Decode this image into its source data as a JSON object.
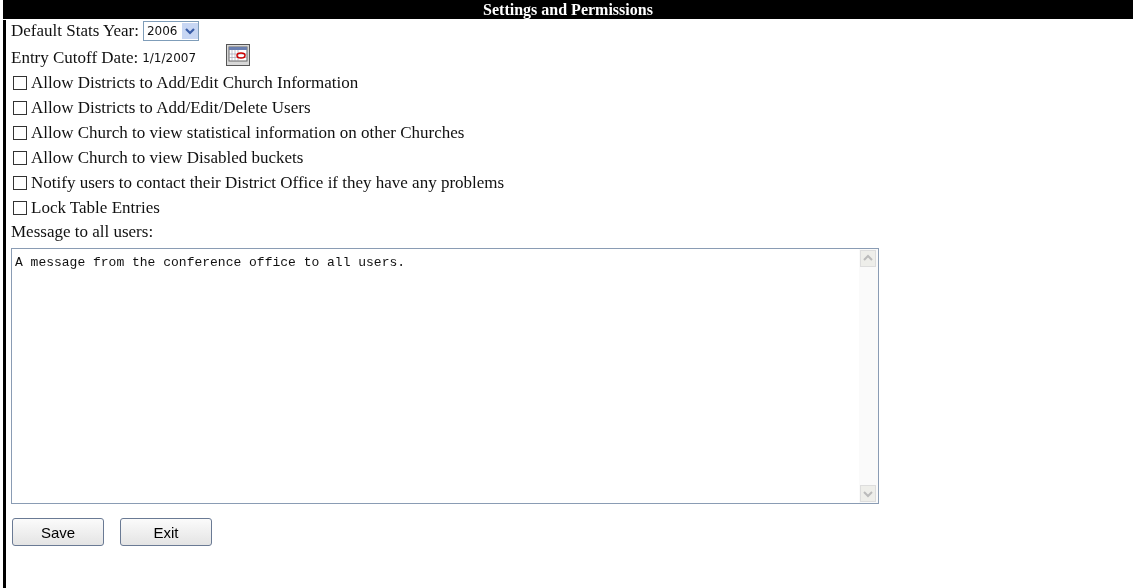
{
  "header": {
    "title": "Settings and Permissions"
  },
  "stats_year": {
    "label": "Default Stats Year:",
    "value": "2006"
  },
  "cutoff": {
    "label": "Entry Cutoff Date:",
    "value": "1/1/2007"
  },
  "options": [
    {
      "label": "Allow Districts to Add/Edit Church Information",
      "checked": false
    },
    {
      "label": "Allow Districts to Add/Edit/Delete Users",
      "checked": false
    },
    {
      "label": "Allow Church to view statistical information on other Churches",
      "checked": false
    },
    {
      "label": "Allow Church to view Disabled buckets",
      "checked": false
    },
    {
      "label": "Notify users to contact their District Office if they have any problems",
      "checked": false
    },
    {
      "label": "Lock Table Entries",
      "checked": false
    }
  ],
  "message": {
    "label": "Message to all users:",
    "value": "A message from the conference office to all users."
  },
  "buttons": [
    "Save",
    "Exit"
  ]
}
